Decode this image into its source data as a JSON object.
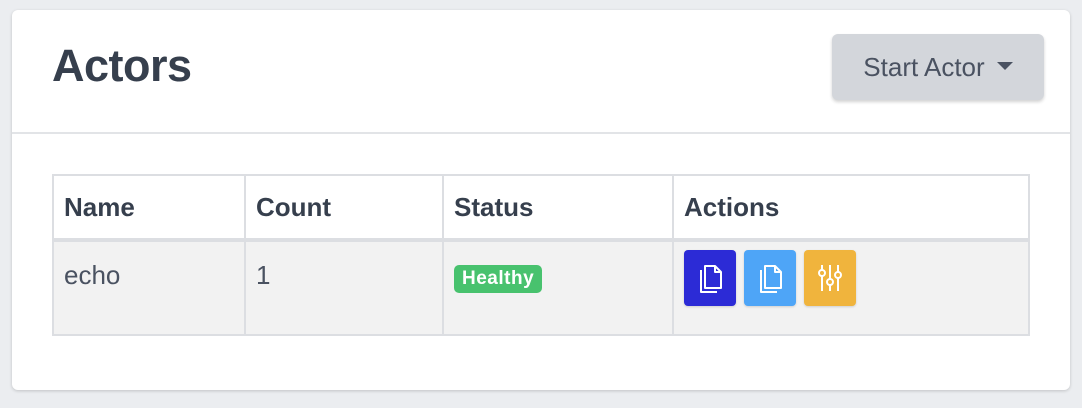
{
  "header": {
    "title": "Actors",
    "start_button_label": "Start Actor"
  },
  "table": {
    "columns": [
      "Name",
      "Count",
      "Status",
      "Actions"
    ],
    "rows": [
      {
        "name": "echo",
        "count": "1",
        "status": "Healthy",
        "actions": [
          {
            "icon": "copy-icon",
            "color": "#2c2bd6"
          },
          {
            "icon": "copy-icon",
            "color": "#4ea5f7"
          },
          {
            "icon": "sliders-icon",
            "color": "#f0b43d"
          }
        ]
      }
    ]
  },
  "colors": {
    "status_healthy": "#48c26e",
    "start_button_bg": "#d3d6db"
  }
}
